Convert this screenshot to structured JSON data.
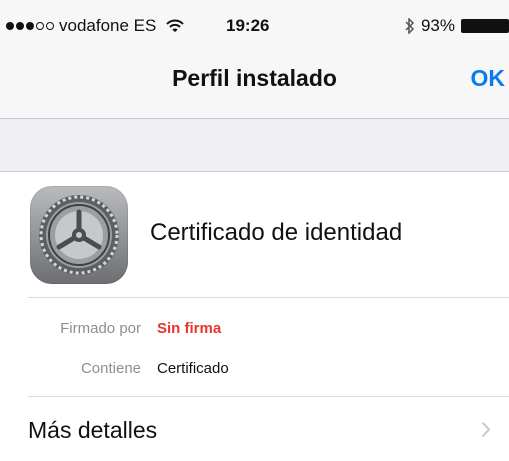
{
  "status_bar": {
    "signal": {
      "filled": 3,
      "empty": 2
    },
    "carrier": "vodafone ES",
    "wifi_icon": "wifi-icon",
    "time": "19:26",
    "bluetooth_icon": "bluetooth-icon",
    "battery_percent": "93%",
    "battery_level": 0.93
  },
  "nav": {
    "title": "Perfil instalado",
    "done_label": "OK",
    "accent_color": "#0a7af0"
  },
  "profile": {
    "icon": "settings-gear-icon",
    "name": "Certificado de identidad"
  },
  "details": {
    "signed_by_label": "Firmado por",
    "signed_by_value": "Sin firma",
    "signed_by_color": "#e8352e",
    "contains_label": "Contiene",
    "contains_value": "Certificado"
  },
  "more_details": {
    "label": "Más detalles",
    "chevron_icon": "chevron-right-icon"
  }
}
